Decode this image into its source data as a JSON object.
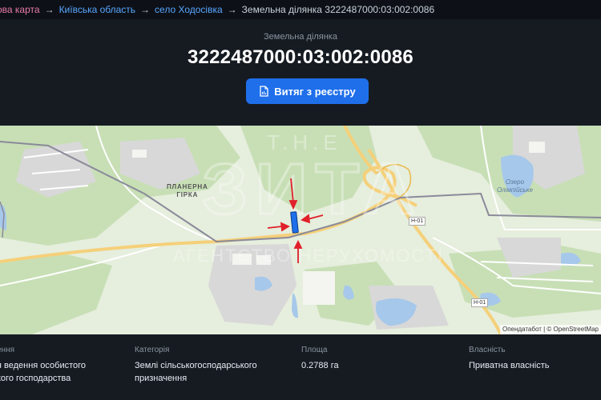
{
  "breadcrumb": {
    "first": "ова карта",
    "sep": "→",
    "region": "Київська область",
    "village": "село Ходосівка",
    "current": "Земельна ділянка 3222487000:03:002:0086"
  },
  "header": {
    "subtitle": "Земельна ділянка",
    "cadastral_number": "3222487000:03:002:0086",
    "extract_button": "Витяг з реєстру",
    "button_color": "#1f6feb"
  },
  "map": {
    "labels": {
      "hill": "ПЛАНЕРНА\nГІРКА",
      "lake": "Озеро\nОлімпійське",
      "road_h01_a": "Н-01",
      "road_h01_b": "Н-01"
    },
    "attribution": "Опендатабот | © OpenStreetMap",
    "parcel_color": "#1f6feb",
    "arrow_color": "#e0202a"
  },
  "info": {
    "purpose": {
      "label": "ення",
      "value": "я ведення особистого\nкого господарства"
    },
    "category": {
      "label": "Категорія",
      "value": "Землі сільськогосподарського\nпризначення"
    },
    "area": {
      "label": "Площа",
      "value": "0.2788 га"
    },
    "ownership": {
      "label": "Власність",
      "value": "Приватна власність"
    }
  }
}
